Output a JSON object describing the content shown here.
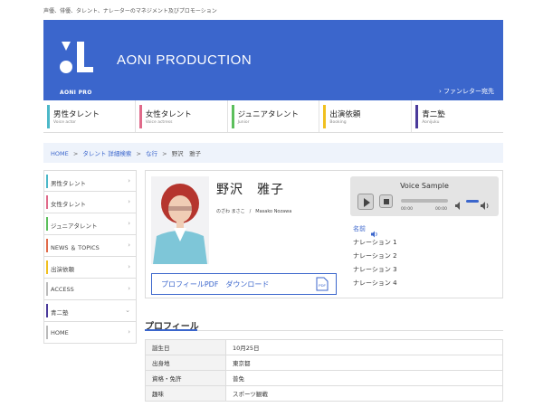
{
  "site": {
    "tagline": "声優、俳優、タレント、ナレーターのマネジメント及びプロモーション",
    "brand": "AONI PRODUCTION",
    "logo_sub": "AONI PRO",
    "fanletter": "ファンレター宛先",
    "accent": "#3b66cc"
  },
  "topnav": [
    {
      "jp": "男性タレント",
      "en": "Voice actor",
      "color": "#4cb8c8"
    },
    {
      "jp": "女性タレント",
      "en": "Voice actress",
      "color": "#e06a8a"
    },
    {
      "jp": "ジュニアタレント",
      "en": "Junior",
      "color": "#5cbf5c"
    },
    {
      "jp": "出演依頼",
      "en": "Booking",
      "color": "#f0c020"
    },
    {
      "jp": "青二塾",
      "en": "Aonijuku",
      "color": "#4a3a9a"
    }
  ],
  "breadcrumb": {
    "home": "HOME",
    "search": "タレント 詳細検索",
    "row": "な行",
    "current": "野沢　雅子",
    "sep": ">"
  },
  "sidebar": [
    {
      "label": "男性タレント",
      "color": "#4cb8c8",
      "icon": "chevron-right-icon"
    },
    {
      "label": "女性タレント",
      "color": "#e06a8a",
      "icon": "chevron-right-icon"
    },
    {
      "label": "ジュニアタレント",
      "color": "#5cbf5c",
      "icon": "chevron-right-icon"
    },
    {
      "label": "NEWS ＆ TOPICS",
      "color": "#e06a4a",
      "icon": "chevron-right-icon"
    },
    {
      "label": "出演依頼",
      "color": "#f0c020",
      "icon": "chevron-right-icon"
    },
    {
      "label": "ACCESS",
      "color": "#bbbbbb",
      "icon": "chevron-right-icon"
    },
    {
      "label": "青二塾",
      "color": "#4a3a9a",
      "icon": "chevron-down-icon"
    },
    {
      "label": "HOME",
      "color": "#bbbbbb",
      "icon": "chevron-right-icon"
    }
  ],
  "chevron_right": "›",
  "chevron_down": "⌄",
  "talent": {
    "name": "野沢　雅子",
    "reading": "のざわ まさこ　/　Masako Nozawa",
    "pdf_label": "プロフィールPDF　ダウンロード",
    "pdf_icon_text": "PDF"
  },
  "voice": {
    "title": "Voice Sample",
    "current_time": "00:00",
    "duration": "00:00",
    "name_label": "名前",
    "samples": [
      "ナレーション 1",
      "ナレーション 2",
      "ナレーション 3",
      "ナレーション 4"
    ]
  },
  "profile": {
    "title": "プロフィール",
    "rows": [
      {
        "k": "誕生日",
        "v": "10月25日"
      },
      {
        "k": "出身地",
        "v": "東京都"
      },
      {
        "k": "資格・免許",
        "v": "普免"
      },
      {
        "k": "趣味",
        "v": "スポーツ観戦"
      }
    ]
  }
}
